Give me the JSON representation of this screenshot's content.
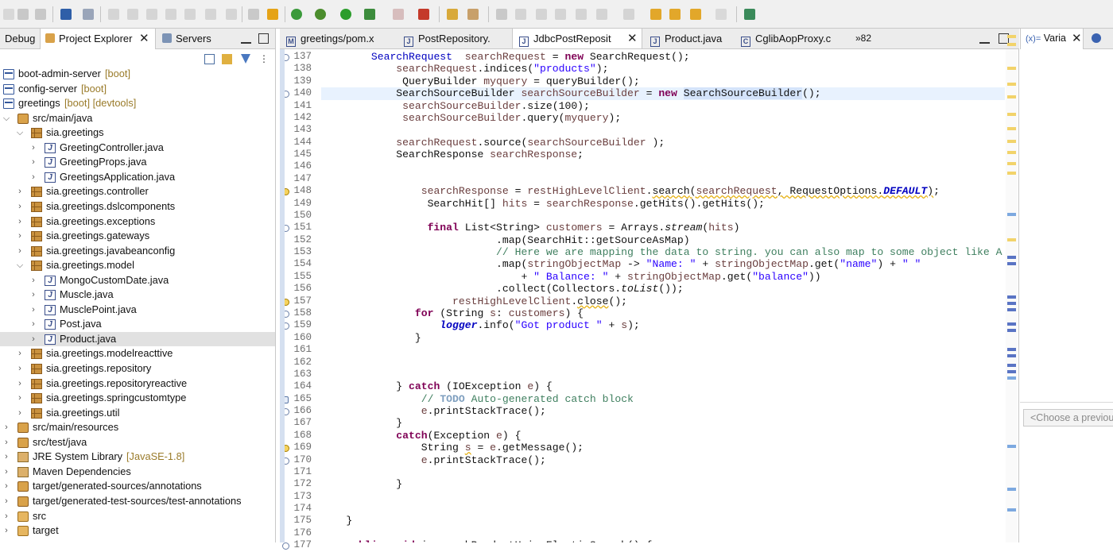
{
  "left_panel": {
    "tabs": {
      "debug": "Debug",
      "project_explorer": "Project Explorer",
      "servers": "Servers"
    },
    "tree": [
      {
        "label": "boot-admin-server",
        "deco": "[boot]",
        "kind": "proj",
        "level": 0,
        "expand": ""
      },
      {
        "label": "config-server",
        "deco": "[boot]",
        "kind": "proj",
        "level": 0,
        "expand": ""
      },
      {
        "label": "greetings",
        "deco": "[boot] [devtools]",
        "kind": "proj",
        "level": 0,
        "expand": ""
      },
      {
        "label": "src/main/java",
        "deco": "",
        "kind": "src",
        "level": 1,
        "expand": "open"
      },
      {
        "label": "sia.greetings",
        "deco": "",
        "kind": "pkg",
        "level": 2,
        "expand": "open"
      },
      {
        "label": "GreetingController.java",
        "deco": "",
        "kind": "java",
        "level": 3,
        "expand": "closed"
      },
      {
        "label": "GreetingProps.java",
        "deco": "",
        "kind": "java",
        "level": 3,
        "expand": "closed"
      },
      {
        "label": "GreetingsApplication.java",
        "deco": "",
        "kind": "java",
        "level": 3,
        "expand": "closed"
      },
      {
        "label": "sia.greetings.controller",
        "deco": "",
        "kind": "pkg",
        "level": 2,
        "expand": "closed"
      },
      {
        "label": "sia.greetings.dslcomponents",
        "deco": "",
        "kind": "pkg",
        "level": 2,
        "expand": "closed"
      },
      {
        "label": "sia.greetings.exceptions",
        "deco": "",
        "kind": "pkg",
        "level": 2,
        "expand": "closed"
      },
      {
        "label": "sia.greetings.gateways",
        "deco": "",
        "kind": "pkg",
        "level": 2,
        "expand": "closed"
      },
      {
        "label": "sia.greetings.javabeanconfig",
        "deco": "",
        "kind": "pkg",
        "level": 2,
        "expand": "closed"
      },
      {
        "label": "sia.greetings.model",
        "deco": "",
        "kind": "pkg",
        "level": 2,
        "expand": "open"
      },
      {
        "label": "MongoCustomDate.java",
        "deco": "",
        "kind": "java",
        "level": 3,
        "expand": "closed"
      },
      {
        "label": "Muscle.java",
        "deco": "",
        "kind": "java",
        "level": 3,
        "expand": "closed"
      },
      {
        "label": "MusclePoint.java",
        "deco": "",
        "kind": "java",
        "level": 3,
        "expand": "closed"
      },
      {
        "label": "Post.java",
        "deco": "",
        "kind": "java",
        "level": 3,
        "expand": "closed"
      },
      {
        "label": "Product.java",
        "deco": "",
        "kind": "java",
        "level": 3,
        "expand": "closed",
        "selected": true
      },
      {
        "label": "sia.greetings.modelreacttive",
        "deco": "",
        "kind": "pkg",
        "level": 2,
        "expand": "closed"
      },
      {
        "label": "sia.greetings.repository",
        "deco": "",
        "kind": "pkg",
        "level": 2,
        "expand": "closed"
      },
      {
        "label": "sia.greetings.repositoryreactive",
        "deco": "",
        "kind": "pkg",
        "level": 2,
        "expand": "closed"
      },
      {
        "label": "sia.greetings.springcustomtype",
        "deco": "",
        "kind": "pkg",
        "level": 2,
        "expand": "closed"
      },
      {
        "label": "sia.greetings.util",
        "deco": "",
        "kind": "pkg",
        "level": 2,
        "expand": "closed"
      },
      {
        "label": "src/main/resources",
        "deco": "",
        "kind": "src",
        "level": 1,
        "expand": "closed"
      },
      {
        "label": "src/test/java",
        "deco": "",
        "kind": "src",
        "level": 1,
        "expand": "closed"
      },
      {
        "label": "JRE System Library",
        "deco": "[JavaSE-1.8]",
        "kind": "lib",
        "level": 1,
        "expand": "closed"
      },
      {
        "label": "Maven Dependencies",
        "deco": "",
        "kind": "lib",
        "level": 1,
        "expand": "closed"
      },
      {
        "label": "target/generated-sources/annotations",
        "deco": "",
        "kind": "src",
        "level": 1,
        "expand": "closed"
      },
      {
        "label": "target/generated-test-sources/test-annotations",
        "deco": "",
        "kind": "src",
        "level": 1,
        "expand": "closed"
      },
      {
        "label": "src",
        "deco": "",
        "kind": "fold",
        "level": 1,
        "expand": "closed"
      },
      {
        "label": "target",
        "deco": "",
        "kind": "fold",
        "level": 1,
        "expand": "closed"
      }
    ]
  },
  "editor": {
    "tabs": [
      {
        "label": "greetings/pom.x",
        "icon": "M"
      },
      {
        "label": "PostRepository.",
        "icon": "J"
      },
      {
        "label": "JdbcPostReposit",
        "icon": "J",
        "active": true
      },
      {
        "label": "Product.java",
        "icon": "J"
      },
      {
        "label": "CglibAopProxy.c",
        "icon": "C"
      }
    ],
    "overflow": "»82",
    "lines": [
      {
        "n": "137",
        "m": "fold",
        "h": "        <span class=\"fld\">SearchRequest</span>  <span class=\"var\">searchRequest</span> = <span class=\"kw\">new</span> SearchRequest();"
      },
      {
        "n": "138",
        "m": "",
        "h": "            <span class=\"var\">searchRequest</span>.indices(<span class=\"str\">\"products\"</span>);"
      },
      {
        "n": "139",
        "m": "",
        "h": "             QueryBuilder <span class=\"var\">myquery</span> = queryBuilder();"
      },
      {
        "n": "140",
        "m": "fold",
        "cur": true,
        "h": "            SearchSourceBuilder <span class=\"var\">searchSourceBuilder</span> = <span class=\"kw\">new</span> <span class=\"hl\">SearchSourceBuilder</span>();"
      },
      {
        "n": "141",
        "m": "",
        "h": "             <span class=\"var\">searchSourceBuilder</span>.size(100);"
      },
      {
        "n": "142",
        "m": "",
        "h": "             <span class=\"var\">searchSourceBuilder</span>.query(<span class=\"var\">myquery</span>);"
      },
      {
        "n": "143",
        "m": "",
        "h": ""
      },
      {
        "n": "144",
        "m": "",
        "h": "            <span class=\"var\">searchRequest</span>.source(<span class=\"var\">searchSourceBuilder</span> );"
      },
      {
        "n": "145",
        "m": "",
        "h": "            SearchResponse <span class=\"var\">searchResponse</span>;"
      },
      {
        "n": "146",
        "m": "",
        "h": ""
      },
      {
        "n": "147",
        "m": "",
        "h": ""
      },
      {
        "n": "148",
        "m": "warn",
        "h": "                <span class=\"var\">searchResponse</span> = <span class=\"var\">restHighLevelClient</span>.<span class=\"strk wav\">search</span><span class=\"wav\">(<span class=\"var\">searchRequest</span>, RequestOptions.<span class=\"sfld\">DEFAULT</span>)</span>;"
      },
      {
        "n": "149",
        "m": "",
        "h": "                 SearchHit[] <span class=\"var\">hits</span> = <span class=\"var\">searchResponse</span>.getHits().getHits();"
      },
      {
        "n": "150",
        "m": "",
        "h": ""
      },
      {
        "n": "151",
        "m": "fold",
        "h": "                 <span class=\"kw\">final</span> List&lt;String&gt; <span class=\"var\">customers</span> = Arrays.<span class=\"it\">stream</span>(<span class=\"var\">hits</span>)"
      },
      {
        "n": "152",
        "m": "",
        "h": "                            .map(SearchHit::getSourceAsMap)"
      },
      {
        "n": "153",
        "m": "",
        "h": "                            <span class=\"cmt\">// Here we are mapping the data to string. you can also map to some object like A</span>"
      },
      {
        "n": "154",
        "m": "",
        "h": "                            .map(<span class=\"var\">stringObjectMap</span> -&gt; <span class=\"str\">\"Name: \"</span> + <span class=\"var\">stringObjectMap</span>.get(<span class=\"str\">\"name\"</span>) + <span class=\"str\">\" \"</span>"
      },
      {
        "n": "155",
        "m": "",
        "h": "                                + <span class=\"str\">\" Balance: \"</span> + <span class=\"var\">stringObjectMap</span>.get(<span class=\"str\">\"balance\"</span>))"
      },
      {
        "n": "156",
        "m": "",
        "h": "                            .collect(Collectors.<span class=\"it\">toList</span>());"
      },
      {
        "n": "157",
        "m": "warn",
        "h": "                     <span class=\"var\">restHighLevelClient</span>.<span class=\"strk wav\">close</span>();"
      },
      {
        "n": "158",
        "m": "fold",
        "h": "               <span class=\"kw\">for</span> (String <span class=\"var\">s</span>: <span class=\"var\">customers</span>) {"
      },
      {
        "n": "159",
        "m": "fold",
        "h": "                   <span class=\"sfld\">logger</span>.info(<span class=\"str\">\"Got product \"</span> + <span class=\"var\">s</span>);"
      },
      {
        "n": "160",
        "m": "",
        "h": "               }"
      },
      {
        "n": "161",
        "m": "",
        "h": ""
      },
      {
        "n": "162",
        "m": "",
        "h": ""
      },
      {
        "n": "163",
        "m": "",
        "h": ""
      },
      {
        "n": "164",
        "m": "",
        "h": "            } <span class=\"kw\">catch</span> (IOException <span class=\"var\">e</span>) {"
      },
      {
        "n": "165",
        "m": "task",
        "h": "                <span class=\"cmt\">// </span><span class=\"todo\">TODO</span><span class=\"cmt\"> Auto-generated catch block</span>"
      },
      {
        "n": "166",
        "m": "fold",
        "h": "                <span class=\"var\">e</span>.printStackTrace();"
      },
      {
        "n": "167",
        "m": "",
        "h": "            }"
      },
      {
        "n": "168",
        "m": "",
        "h": "            <span class=\"kw\">catch</span>(Exception <span class=\"var\">e</span>) {"
      },
      {
        "n": "169",
        "m": "warn",
        "h": "                String <span class=\"var wav\">s</span> = <span class=\"var\">e</span>.getMessage();"
      },
      {
        "n": "170",
        "m": "fold",
        "h": "                <span class=\"var\">e</span>.printStackTrace();"
      },
      {
        "n": "171",
        "m": "",
        "h": ""
      },
      {
        "n": "172",
        "m": "",
        "h": "            }"
      },
      {
        "n": "173",
        "m": "",
        "h": ""
      },
      {
        "n": "174",
        "m": "",
        "h": ""
      },
      {
        "n": "175",
        "m": "",
        "h": "    }"
      },
      {
        "n": "176",
        "m": "",
        "h": ""
      },
      {
        "n": "177",
        "m": "fold",
        "h": "    <span class=\"kw\">public void</span> iosearchProductUsingElasticSearch() {"
      }
    ]
  },
  "right_panel": {
    "tab_label": "Varia",
    "choose_placeholder": "<Choose a previou"
  },
  "colors": {
    "keyword": "#7f0055",
    "string": "#2a00ff",
    "comment": "#3f7f5f",
    "field": "#0000c0",
    "local_var": "#6a3e3e",
    "current_line": "#e8f2fe",
    "selection_row": "#e1e1e1"
  },
  "icons": [
    "run-icon",
    "debug-icon",
    "stop-icon",
    "search-icon",
    "filter-icon",
    "collapse-all-icon",
    "link-editor-icon",
    "close-icon",
    "minimize-icon",
    "maximize-icon"
  ]
}
